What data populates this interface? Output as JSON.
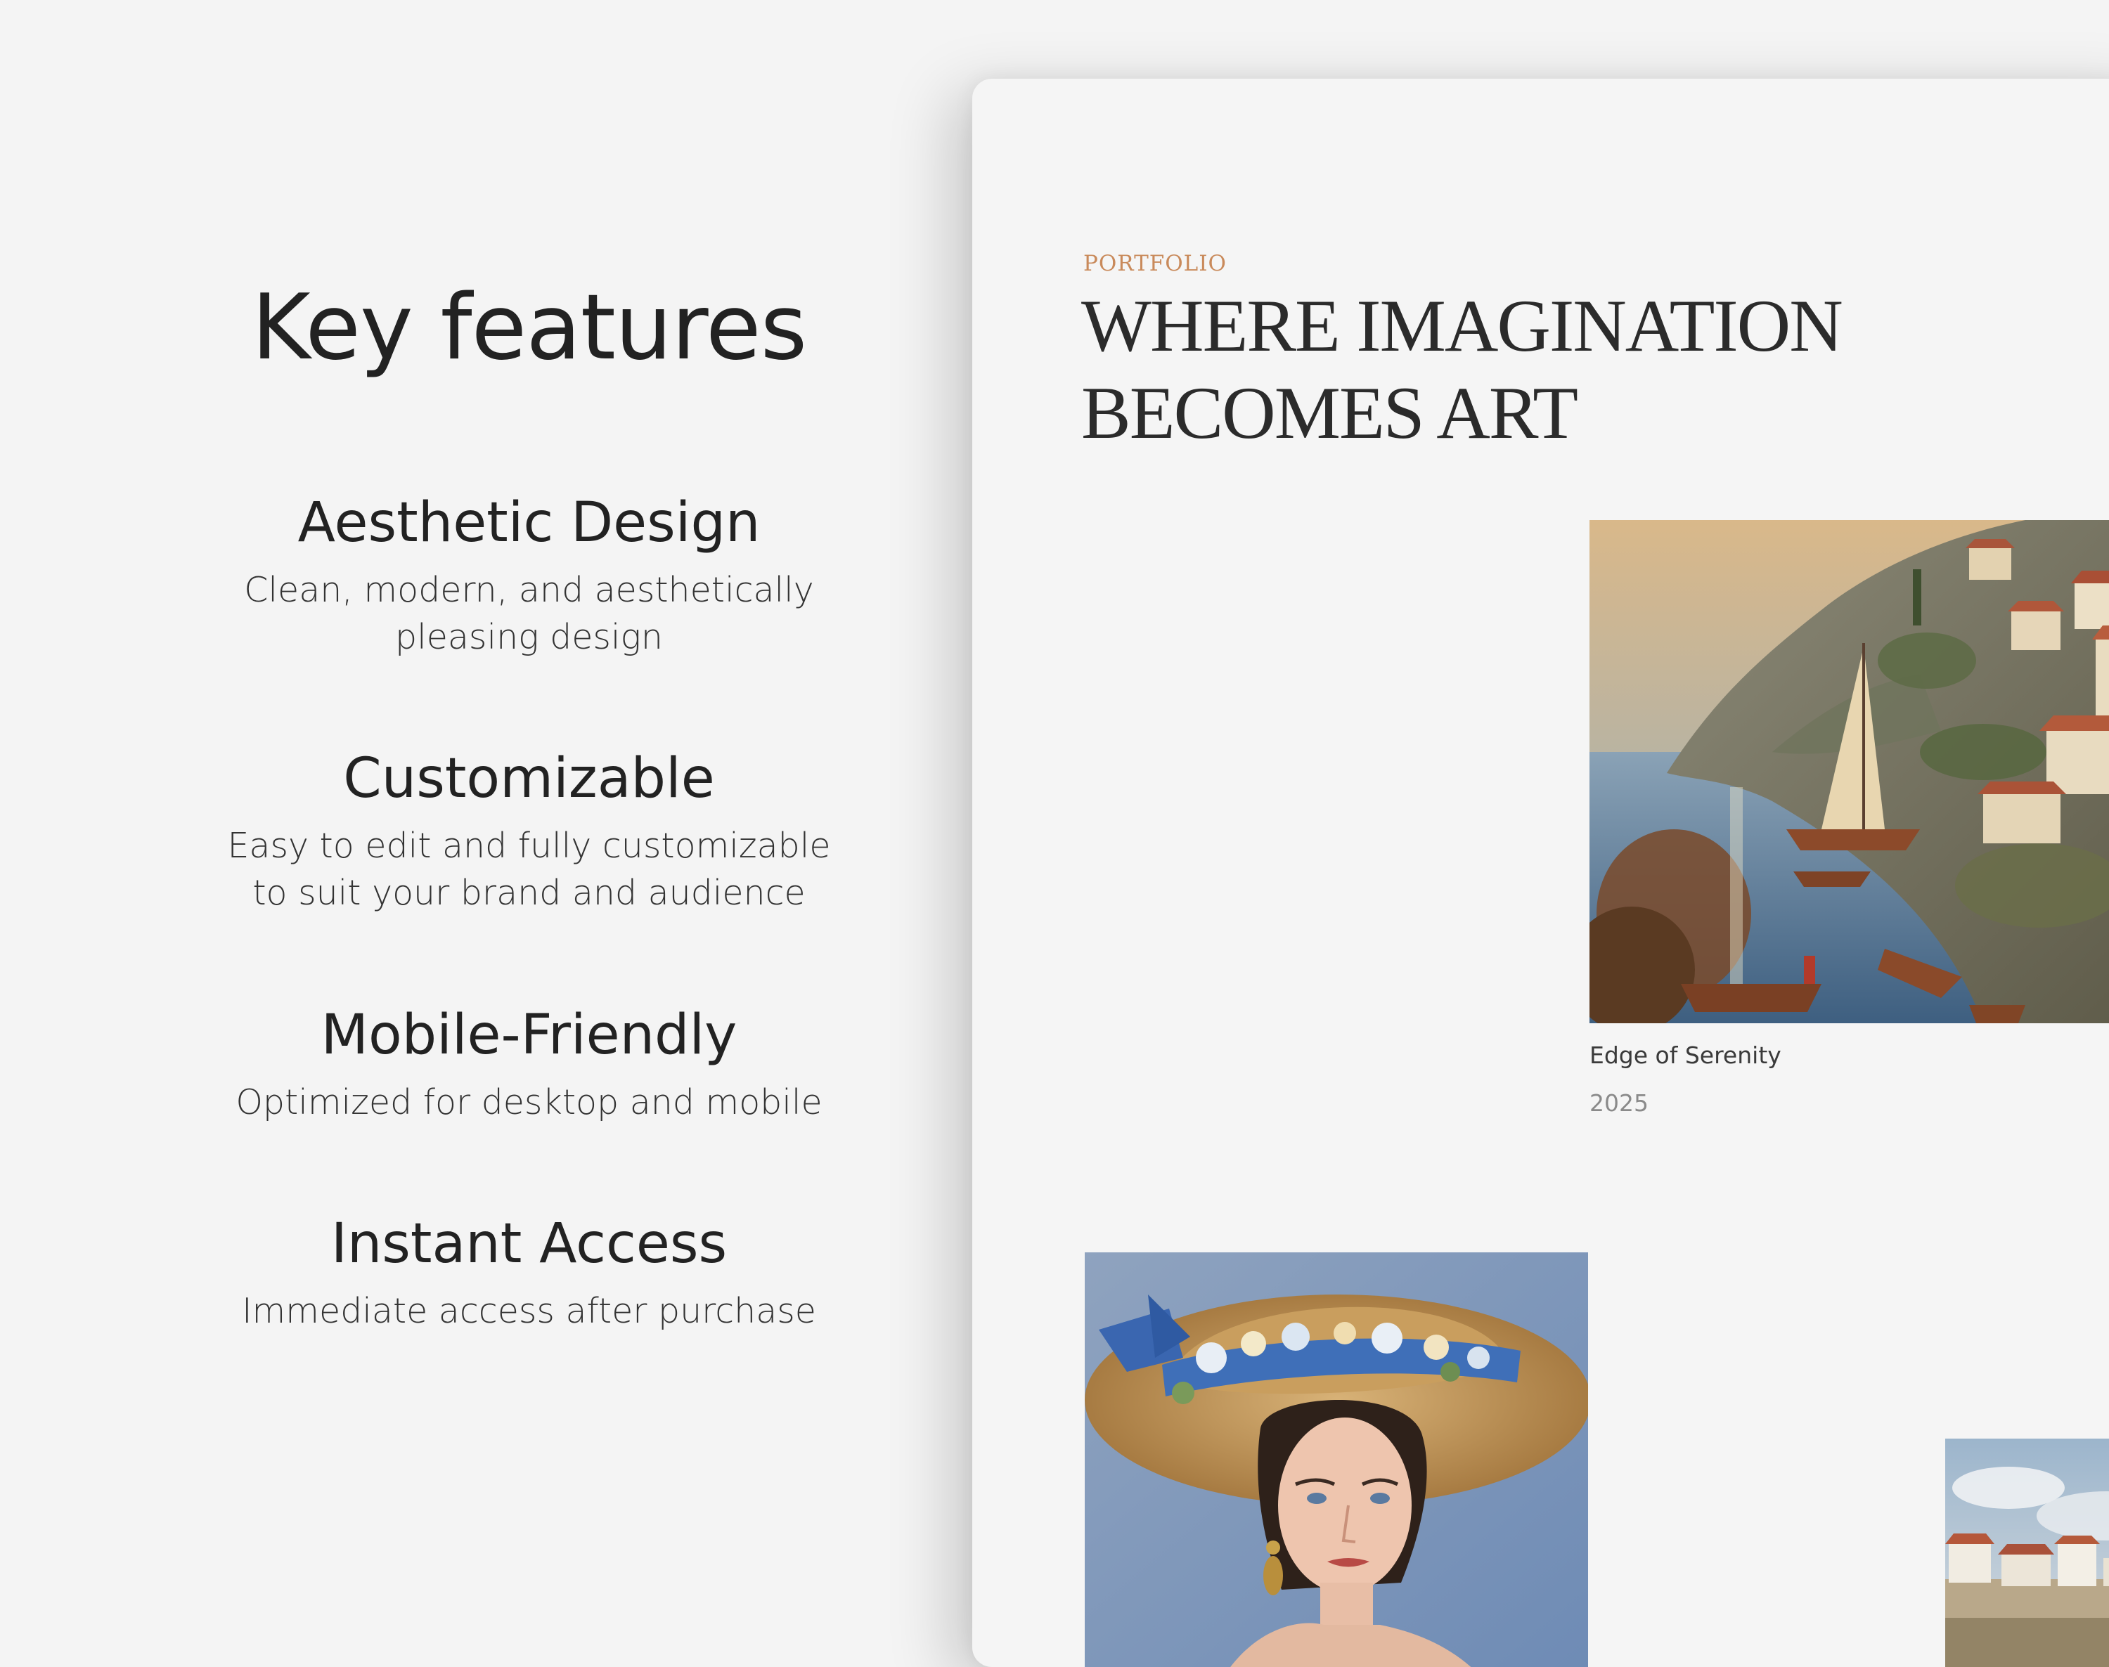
{
  "features": {
    "title": "Key features",
    "items": [
      {
        "name": "Aesthetic Design",
        "description": "Clean, modern, and aesthetically pleasing design"
      },
      {
        "name": "Customizable",
        "description": "Easy to edit and fully customizable to suit your brand and audience"
      },
      {
        "name": "Mobile-Friendly",
        "description": "Optimized for desktop and mobile"
      },
      {
        "name": "Instant Access",
        "description": "Immediate access after purchase"
      }
    ]
  },
  "portfolio": {
    "eyebrow": "PORTFOLIO",
    "headline": "WHERE IMAGINATION BECOMES ART",
    "artworks": [
      {
        "title": "Edge of Serenity",
        "year": "2025",
        "image": "coastal-village-painting"
      },
      {
        "image": "woman-in-flowered-hat-painting"
      },
      {
        "image": "seaside-houses-painting"
      }
    ]
  },
  "colors": {
    "page_background": "#f4f4f4",
    "card_background": "#f5f5f5",
    "accent": "#c98a5b",
    "heading_text": "#222222",
    "muted_text": "#8a8a8a"
  }
}
